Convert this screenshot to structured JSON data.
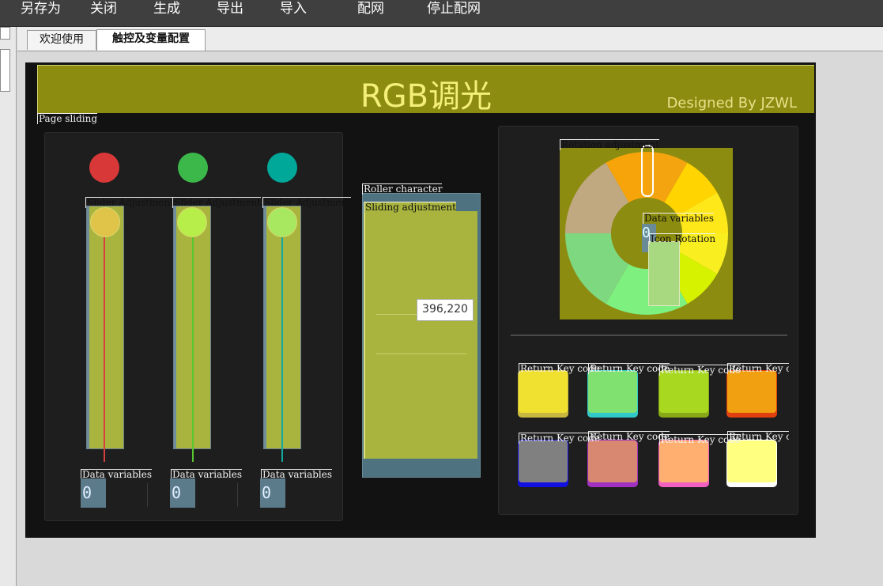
{
  "menu": {
    "items": [
      "另存为",
      "关闭",
      "生成",
      "导出",
      "导入",
      "配网",
      "停止配网"
    ]
  },
  "tabs": [
    {
      "label": "欢迎使用",
      "active": false
    },
    {
      "label": "触控及变量配置",
      "active": true
    }
  ],
  "screen": {
    "title": "RGB调光",
    "subtitle": "Designed By JZWL",
    "page_sliding_tag": "Page sliding",
    "sliders": [
      {
        "tag": "Slider Adjustment",
        "dot_color": "#d83838",
        "knob_color": "#e0c44a",
        "line_color": "#d84040",
        "value": "0",
        "var_tag": "Data variables"
      },
      {
        "tag": "Slider Adjustment",
        "dot_color": "#3cb84a",
        "knob_color": "#b8ee4a",
        "line_color": "#58c830",
        "value": "0",
        "var_tag": "Data variables"
      },
      {
        "tag": "Slider Adjustment",
        "dot_color": "#00a89a",
        "knob_color": "#a8e860",
        "line_color": "#10a8a0",
        "value": "0",
        "var_tag": "Data variables"
      }
    ],
    "roller_tag": "Roller character",
    "sliding_adjust_tag": "Sliding adjustment",
    "tooltip": "396,220",
    "rotation_tag": "Rotation adjustment",
    "data_var_tag": "Data variables",
    "icon_rotation_tag": "Icon Rotation",
    "wheel_value": "0",
    "return_keys": [
      {
        "tag": "Return Key code",
        "face": "#f0e030",
        "edge": "#c8b840"
      },
      {
        "tag": "Return Key code",
        "face": "#80e070",
        "edge": "#30c8c8"
      },
      {
        "tag": "Return Key code",
        "face": "#a8d820",
        "edge": "#88a818"
      },
      {
        "tag": "Return Key code",
        "face": "#f0a010",
        "edge": "#e04010"
      },
      {
        "tag": "Return Key code",
        "face": "#808080",
        "edge": "#1010e0"
      },
      {
        "tag": "Return Key code",
        "face": "#d88870",
        "edge": "#a030c0"
      },
      {
        "tag": "Return Key code",
        "face": "#ffb070",
        "edge": "#f060c0"
      },
      {
        "tag": "Return Key code",
        "face": "#ffff80",
        "edge": "#ffffff"
      }
    ]
  }
}
